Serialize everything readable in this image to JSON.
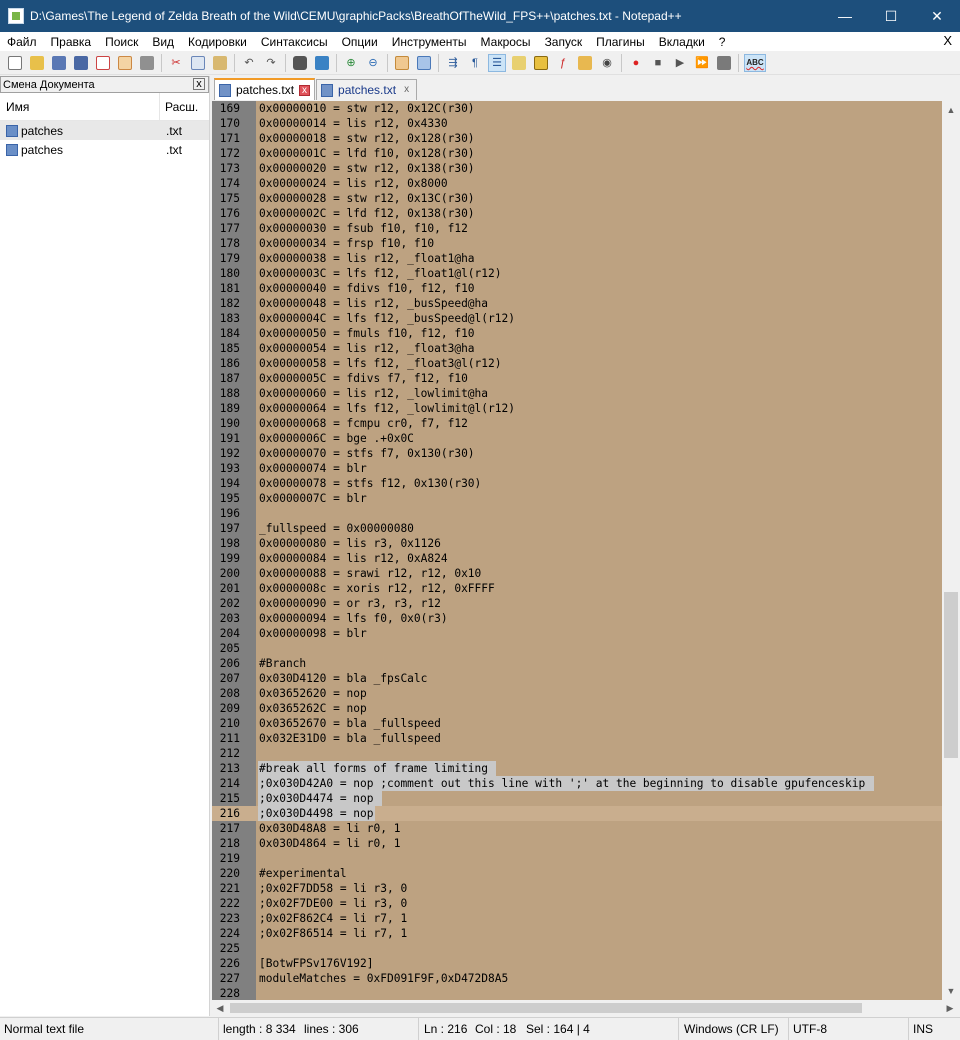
{
  "window": {
    "title": "D:\\Games\\The Legend of Zelda Breath of the Wild\\CEMU\\graphicPacks\\BreathOfTheWild_FPS++\\patches.txt - Notepad++",
    "minimize": "—",
    "maximize": "☐",
    "close": "✕"
  },
  "menu": {
    "items": [
      "Файл",
      "Правка",
      "Поиск",
      "Вид",
      "Кодировки",
      "Синтаксисы",
      "Опции",
      "Инструменты",
      "Макросы",
      "Запуск",
      "Плагины",
      "Вкладки",
      "?"
    ],
    "close": "X"
  },
  "toolbar": {
    "icons": [
      "new-file-icon",
      "open-file-icon",
      "save-icon",
      "save-all-icon",
      "close-file-icon",
      "close-all-icon",
      "print-icon",
      "cut-icon",
      "copy-icon",
      "paste-icon",
      "undo-icon",
      "redo-icon",
      "find-icon",
      "replace-icon",
      "zoom-in-icon",
      "zoom-out-icon",
      "sync-vertical-icon",
      "sync-horizontal-icon",
      "word-wrap-icon",
      "show-all-chars-icon",
      "indent-guide-icon",
      "language-icon",
      "doc-map-icon",
      "function-list-icon",
      "folder-workspace-icon",
      "monitor-icon",
      "record-macro-icon",
      "stop-record-icon",
      "play-macro-icon",
      "run-macro-multiple-icon",
      "save-macro-icon",
      "spellcheck-icon"
    ],
    "spellcheck_label": "ABC"
  },
  "doc_switcher": {
    "title": "Смена Документа",
    "close": "x",
    "col_name": "Имя",
    "col_ext": "Расш.",
    "files": [
      {
        "name": "patches",
        "ext": ".txt"
      },
      {
        "name": "patches",
        "ext": ".txt"
      }
    ]
  },
  "tabs": [
    {
      "label": "patches.txt",
      "close": "x"
    },
    {
      "label": "patches.txt",
      "close": "x"
    }
  ],
  "editor": {
    "bg_color": "#bda281",
    "lines": [
      {
        "n": "169",
        "t": "0x00000010 = stw r12, 0x12C(r30)"
      },
      {
        "n": "170",
        "t": "0x00000014 = lis r12, 0x4330"
      },
      {
        "n": "171",
        "t": "0x00000018 = stw r12, 0x128(r30)"
      },
      {
        "n": "172",
        "t": "0x0000001C = lfd f10, 0x128(r30)"
      },
      {
        "n": "173",
        "t": "0x00000020 = stw r12, 0x138(r30)"
      },
      {
        "n": "174",
        "t": "0x00000024 = lis r12, 0x8000"
      },
      {
        "n": "175",
        "t": "0x00000028 = stw r12, 0x13C(r30)"
      },
      {
        "n": "176",
        "t": "0x0000002C = lfd f12, 0x138(r30)"
      },
      {
        "n": "177",
        "t": "0x00000030 = fsub f10, f10, f12"
      },
      {
        "n": "178",
        "t": "0x00000034 = frsp f10, f10"
      },
      {
        "n": "179",
        "t": "0x00000038 = lis r12, _float1@ha"
      },
      {
        "n": "180",
        "t": "0x0000003C = lfs f12, _float1@l(r12)"
      },
      {
        "n": "181",
        "t": "0x00000040 = fdivs f10, f12, f10"
      },
      {
        "n": "182",
        "t": "0x00000048 = lis r12, _busSpeed@ha"
      },
      {
        "n": "183",
        "t": "0x0000004C = lfs f12, _busSpeed@l(r12)"
      },
      {
        "n": "184",
        "t": "0x00000050 = fmuls f10, f12, f10"
      },
      {
        "n": "185",
        "t": "0x00000054 = lis r12, _float3@ha"
      },
      {
        "n": "186",
        "t": "0x00000058 = lfs f12, _float3@l(r12)"
      },
      {
        "n": "187",
        "t": "0x0000005C = fdivs f7, f12, f10"
      },
      {
        "n": "188",
        "t": "0x00000060 = lis r12, _lowlimit@ha"
      },
      {
        "n": "189",
        "t": "0x00000064 = lfs f12, _lowlimit@l(r12)"
      },
      {
        "n": "190",
        "t": "0x00000068 = fcmpu cr0, f7, f12"
      },
      {
        "n": "191",
        "t": "0x0000006C = bge .+0x0C"
      },
      {
        "n": "192",
        "t": "0x00000070 = stfs f7, 0x130(r30)"
      },
      {
        "n": "193",
        "t": "0x00000074 = blr"
      },
      {
        "n": "194",
        "t": "0x00000078 = stfs f12, 0x130(r30)"
      },
      {
        "n": "195",
        "t": "0x0000007C = blr"
      },
      {
        "n": "196",
        "t": ""
      },
      {
        "n": "197",
        "t": "_fullspeed = 0x00000080"
      },
      {
        "n": "198",
        "t": "0x00000080 = lis r3, 0x1126"
      },
      {
        "n": "199",
        "t": "0x00000084 = lis r12, 0xA824"
      },
      {
        "n": "200",
        "t": "0x00000088 = srawi r12, r12, 0x10"
      },
      {
        "n": "201",
        "t": "0x0000008c = xoris r12, r12, 0xFFFF"
      },
      {
        "n": "202",
        "t": "0x00000090 = or r3, r3, r12"
      },
      {
        "n": "203",
        "t": "0x00000094 = lfs f0, 0x0(r3)"
      },
      {
        "n": "204",
        "t": "0x00000098 = blr"
      },
      {
        "n": "205",
        "t": ""
      },
      {
        "n": "206",
        "t": "#Branch"
      },
      {
        "n": "207",
        "t": "0x030D4120 = bla _fpsCalc"
      },
      {
        "n": "208",
        "t": "0x03652620 = nop"
      },
      {
        "n": "209",
        "t": "0x0365262C = nop"
      },
      {
        "n": "210",
        "t": "0x03652670 = bla _fullspeed"
      },
      {
        "n": "211",
        "t": "0x032E31D0 = bla _fullspeed"
      },
      {
        "n": "212",
        "t": ""
      },
      {
        "n": "213",
        "t": "#break all forms of frame limiting ",
        "sel": true
      },
      {
        "n": "214",
        "t": ";0x030D42A0 = nop ;comment out this line with ';' at the beginning to disable gpufenceskip ",
        "sel": true
      },
      {
        "n": "215",
        "t": ";0x030D4474 = nop ",
        "sel": true
      },
      {
        "n": "216",
        "t": ";0x030D4498 = nop",
        "sel": true,
        "caret": true
      },
      {
        "n": "217",
        "t": "0x030D48A8 = li r0, 1"
      },
      {
        "n": "218",
        "t": "0x030D4864 = li r0, 1"
      },
      {
        "n": "219",
        "t": ""
      },
      {
        "n": "220",
        "t": "#experimental"
      },
      {
        "n": "221",
        "t": ";0x02F7DD58 = li r3, 0"
      },
      {
        "n": "222",
        "t": ";0x02F7DE00 = li r3, 0"
      },
      {
        "n": "223",
        "t": ";0x02F862C4 = li r7, 1"
      },
      {
        "n": "224",
        "t": ";0x02F86514 = li r7, 1"
      },
      {
        "n": "225",
        "t": ""
      },
      {
        "n": "226",
        "t": "[BotwFPSv176V192]"
      },
      {
        "n": "227",
        "t": "moduleMatches = 0xFD091F9F,0xD472D8A5"
      },
      {
        "n": "228",
        "t": ""
      }
    ]
  },
  "status": {
    "filetype": "Normal text file",
    "length": "length : 8 334",
    "lines": "lines : 306",
    "ln": "Ln : 216",
    "col": "Col : 18",
    "sel": "Sel : 164 | 4",
    "eol": "Windows (CR LF)",
    "encoding": "UTF-8",
    "mode": "INS"
  }
}
